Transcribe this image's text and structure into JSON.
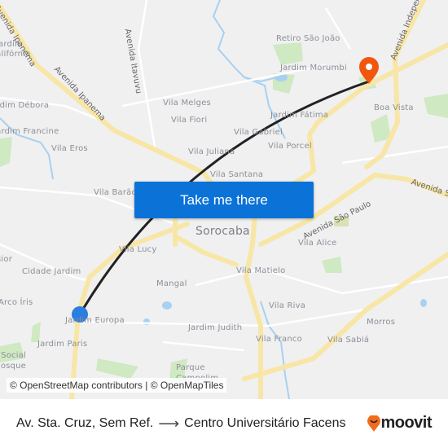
{
  "map": {
    "labels": [
      "Retiro São João",
      "Jardim Morumbi",
      "Vila Melges",
      "Vila Fiori",
      "Jardim Fátima",
      "Boa Vista",
      "Vila Gabriel",
      "Vila Porcel",
      "Vila Juliana",
      "Vila Santana",
      "Vila Eros",
      "Jardim Francine",
      "Jardim Débora",
      "Jardim Califórnia",
      "Vila Barão",
      "Vila Lucy",
      "Cidade Jardim",
      "Arco Íris",
      "Jardim Europa",
      "Jardim Paris",
      "Mangal",
      "Jardim Judith",
      "Vila Matielo",
      "Vila Alice",
      "Vila Riva",
      "Vila Franco",
      "Vila Sabiá",
      "Morros",
      "Parque Campolim",
      "Social Bosque",
      "Sorocaba",
      "sior"
    ],
    "road_labels": [
      "Avenida Ipanema",
      "Avenida Ipanema",
      "Avenida Itavuvu",
      "Avenida Independência",
      "Avenida São Paulo",
      "Avenida São Paulo"
    ],
    "colors": {
      "road": "#f8e6a6",
      "route": "#222222",
      "origin": "#2a7de1",
      "destination": "#f2560d",
      "water": "#a8d0f0",
      "park": "#cde8c0"
    },
    "origin_icon": "origin-dot-icon",
    "destination_icon": "destination-pin-icon"
  },
  "cta": {
    "label": "Take me there"
  },
  "attribution": "© OpenStreetMap contributors | © OpenMapTiles",
  "footer": {
    "from": "Av. Sta. Cruz, Sem Ref.",
    "arrow_icon": "arrow-right-icon",
    "to": "Centro Universitário Facens"
  },
  "brand": {
    "name": "moovit",
    "color": "#f26b1d"
  }
}
